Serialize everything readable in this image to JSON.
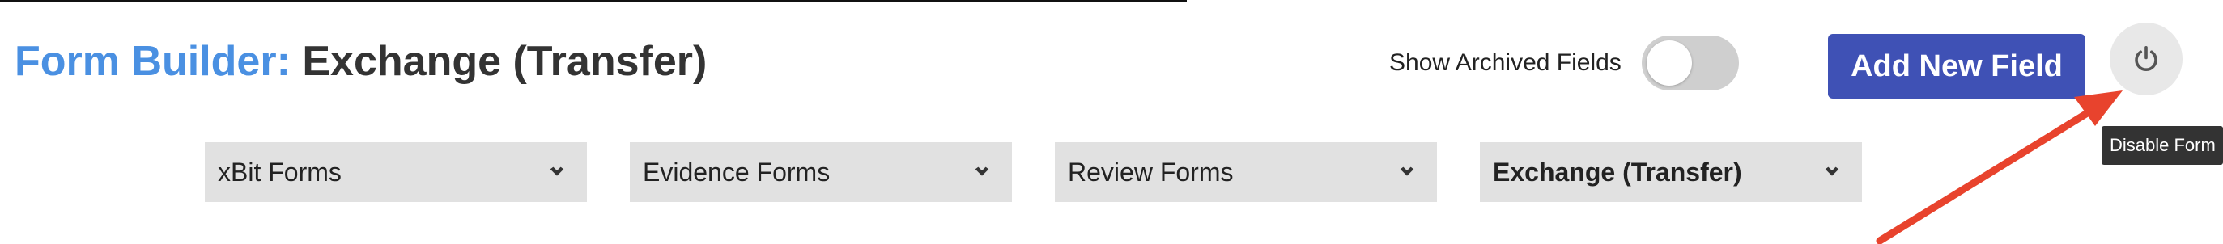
{
  "header": {
    "title_prefix": "Form Builder:",
    "title_name": "Exchange (Transfer)"
  },
  "archived_toggle": {
    "label": "Show Archived Fields",
    "on": false
  },
  "actions": {
    "add_field_label": "Add New Field",
    "power_icon": "power-icon",
    "tooltip": "Disable Form"
  },
  "form_selects": [
    {
      "label": "xBit Forms"
    },
    {
      "label": "Evidence Forms"
    },
    {
      "label": "Review Forms"
    },
    {
      "label": "Exchange (Transfer)",
      "active": true
    }
  ],
  "colors": {
    "accent": "#4a90e2",
    "primary_button": "#3f51b5",
    "annotation_arrow": "#e8432d"
  }
}
